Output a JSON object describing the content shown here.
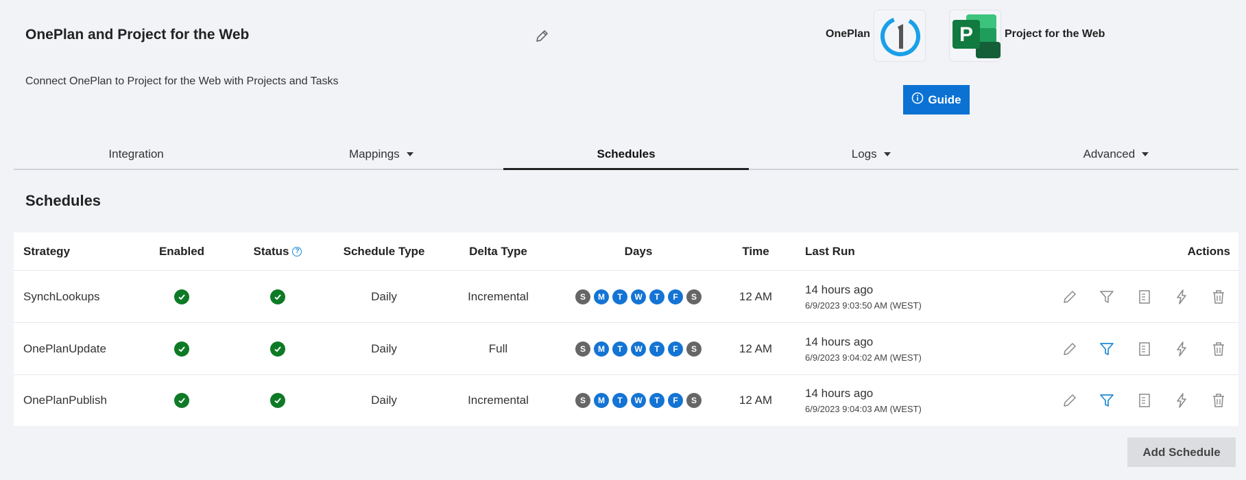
{
  "header": {
    "title": "OnePlan and Project for the Web",
    "subtitle": "Connect OnePlan to Project for the Web with Projects and Tasks",
    "left_brand": "OnePlan",
    "right_brand": "Project for the Web",
    "guide_label": "Guide"
  },
  "tabs": [
    {
      "label": "Integration",
      "dropdown": false,
      "active": false
    },
    {
      "label": "Mappings",
      "dropdown": true,
      "active": false
    },
    {
      "label": "Schedules",
      "dropdown": false,
      "active": true
    },
    {
      "label": "Logs",
      "dropdown": true,
      "active": false
    },
    {
      "label": "Advanced",
      "dropdown": true,
      "active": false
    }
  ],
  "section_title": "Schedules",
  "table": {
    "columns": {
      "strategy": "Strategy",
      "enabled": "Enabled",
      "status": "Status",
      "schedule_type": "Schedule Type",
      "delta_type": "Delta Type",
      "days": "Days",
      "time": "Time",
      "last_run": "Last Run",
      "actions": "Actions"
    },
    "rows": [
      {
        "strategy": "SynchLookups",
        "schedule_type": "Daily",
        "delta_type": "Incremental",
        "days": [
          "S",
          "M",
          "T",
          "W",
          "T",
          "F",
          "S"
        ],
        "time": "12 AM",
        "last_run_ago": "14 hours ago",
        "last_run_ts": "6/9/2023 9:03:50 AM (WEST)",
        "filter_active": false
      },
      {
        "strategy": "OnePlanUpdate",
        "schedule_type": "Daily",
        "delta_type": "Full",
        "days": [
          "S",
          "M",
          "T",
          "W",
          "T",
          "F",
          "S"
        ],
        "time": "12 AM",
        "last_run_ago": "14 hours ago",
        "last_run_ts": "6/9/2023 9:04:02 AM (WEST)",
        "filter_active": true
      },
      {
        "strategy": "OnePlanPublish",
        "schedule_type": "Daily",
        "delta_type": "Incremental",
        "days": [
          "S",
          "M",
          "T",
          "W",
          "T",
          "F",
          "S"
        ],
        "time": "12 AM",
        "last_run_ago": "14 hours ago",
        "last_run_ts": "6/9/2023 9:04:03 AM (WEST)",
        "filter_active": true
      }
    ]
  },
  "add_schedule_label": "Add Schedule",
  "colors": {
    "accent": "#0b72d4",
    "enabled_green": "#0e7a25",
    "day_on": "#1474d4",
    "day_off": "#666666"
  }
}
